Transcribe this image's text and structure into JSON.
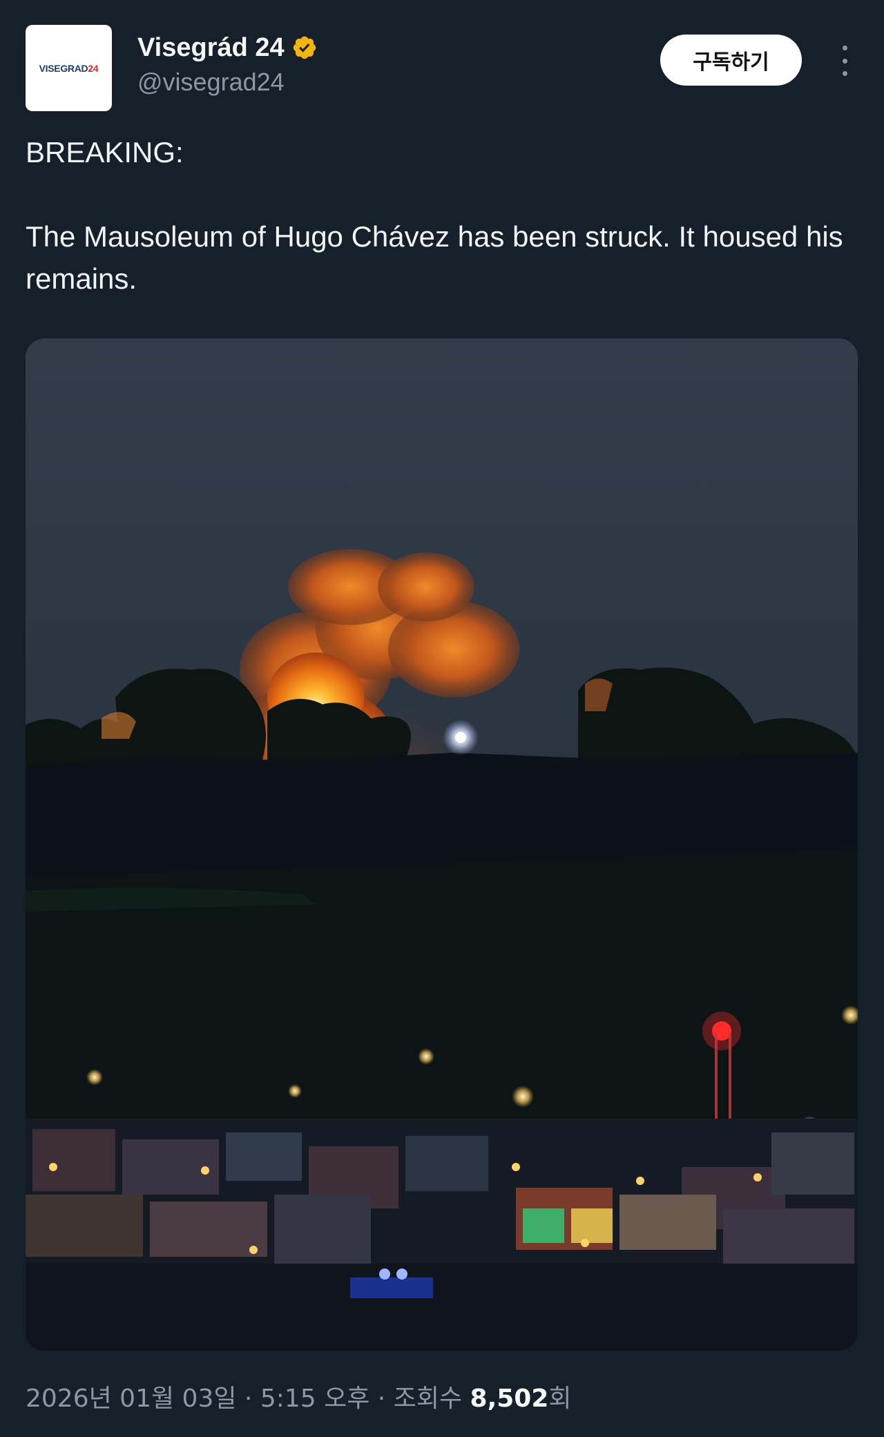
{
  "account": {
    "avatar_logo_text": "VISEGRAD",
    "avatar_logo_number": "24",
    "display_name": "Visegrád 24",
    "handle": "@visegrad24",
    "verified_badge_color": "#f2b40d"
  },
  "actions": {
    "subscribe_label": "구독하기",
    "more_icon": "more-vertical-icon"
  },
  "post": {
    "line1": "BREAKING:",
    "line2": "The Mausoleum of Hugo Chávez has been struck. It housed his remains."
  },
  "media": {
    "description_kind": "photo"
  },
  "meta": {
    "date": "2026년 01월 03일",
    "sep1": " · ",
    "time": "5:15 오후",
    "sep2": " · ",
    "views_label": "조회수 ",
    "views_count": "8,502",
    "views_suffix": "회"
  },
  "colors": {
    "background": "#15202b",
    "text": "#e7e9ea",
    "muted": "#8b98a5",
    "button_bg": "#ffffff"
  }
}
